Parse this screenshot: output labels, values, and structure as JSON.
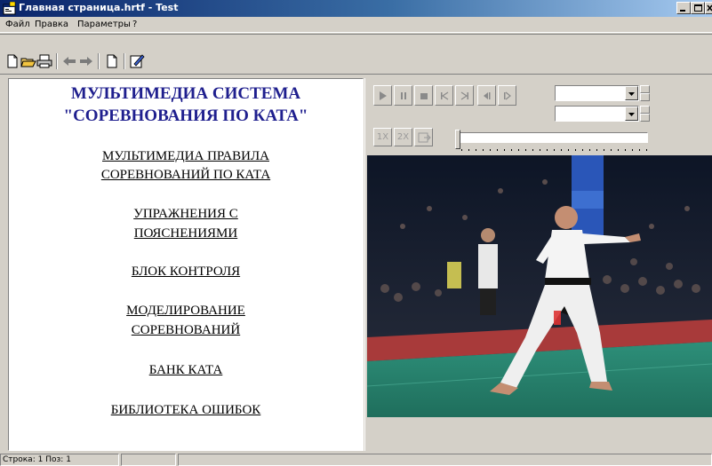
{
  "window": {
    "title": "Главная страница.hrtf - Test",
    "title_color": "#0a246a"
  },
  "menu": {
    "items": [
      {
        "label": "Файл"
      },
      {
        "label": "Правка"
      },
      {
        "label": "Параметры"
      },
      {
        "label": "?"
      }
    ]
  },
  "toolbar": {
    "icons": [
      "new-file-icon",
      "open-folder-icon",
      "print-icon",
      "back-arrow-icon",
      "forward-arrow-icon",
      "page-icon",
      "edit-icon"
    ]
  },
  "content": {
    "heading_line1": "МУЛЬТИМЕДИА СИСТЕМА",
    "heading_line2": "\"СОРЕВНОВАНИЯ ПО КАТА\"",
    "heading_color": "#1f1f8e",
    "links": [
      {
        "line1": "МУЛЬТИМЕДИА ПРАВИЛА ",
        "line2": "СОРЕВНОВАНИЙ ПО КАТА"
      },
      {
        "line1": "УПРАЖНЕНИЯ С ",
        "line2": "ПОЯСНЕНИЯМИ"
      },
      {
        "line1": "БЛОК КОНТРОЛЯ",
        "line2": ""
      },
      {
        "line1": "МОДЕЛИРОВАНИЕ ",
        "line2": "СОРЕВНОВАНИЙ"
      },
      {
        "line1": "БАНК КАТА",
        "line2": ""
      },
      {
        "line1": "БИБЛИОТЕКА ОШИБОК",
        "line2": ""
      }
    ]
  },
  "player": {
    "controls": [
      "play-icon",
      "pause-icon",
      "stop-icon",
      "skip-start-icon",
      "skip-end-icon",
      "step-back-icon",
      "step-forward-icon"
    ],
    "speed_1x": "1X",
    "speed_2x": "2X",
    "combo1_value": "",
    "combo2_value": "",
    "position_fraction": 0.0
  },
  "status": {
    "row_label": "Строка:",
    "row_value": "1",
    "pos_label": "Поз:",
    "pos_value": "1"
  }
}
